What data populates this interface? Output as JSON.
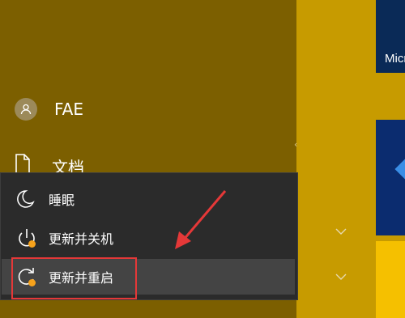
{
  "start_menu": {
    "user": {
      "name": "FAE",
      "avatar_icon": "user-icon"
    },
    "documents_label": "文档"
  },
  "power_menu": {
    "items": [
      {
        "label": "睡眠",
        "icon": "sleep-moon-icon"
      },
      {
        "label": "更新并关机",
        "icon": "update-shutdown-icon"
      },
      {
        "label": "更新并重启",
        "icon": "update-restart-icon",
        "selected": true
      }
    ]
  },
  "tiles": {
    "top_tile_text": "Micr"
  },
  "colors": {
    "left_pane": "#7c5f00",
    "tile_area": "#c79b00",
    "menu_bg": "#2b2b2b",
    "update_dot": "#f7a21b",
    "annotation_red": "#e53838"
  }
}
